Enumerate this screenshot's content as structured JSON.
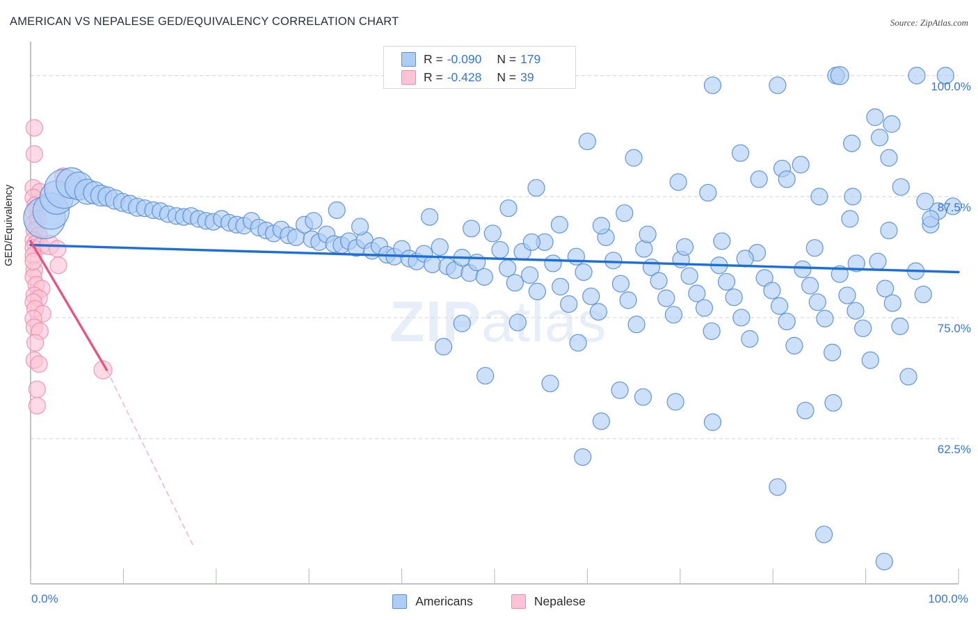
{
  "header": {
    "title": "AMERICAN VS NEPALESE GED/EQUIVALENCY CORRELATION CHART",
    "source": "Source: ZipAtlas.com"
  },
  "watermark": {
    "bold": "ZIP",
    "rest": "atlas"
  },
  "legend": {
    "rows": [
      {
        "series": "Americans",
        "color": "#aecdf5",
        "r_label": "R = ",
        "r_value": "-0.090",
        "n_label": "N = ",
        "n_value": "179"
      },
      {
        "series": "Nepalese",
        "color": "#fbc3d5",
        "r_label": "R = ",
        "r_value": "-0.428",
        "n_label": "N = ",
        "n_value": "39"
      }
    ]
  },
  "bottom_legend": [
    {
      "label": "Americans",
      "color": "#aecdf5"
    },
    {
      "label": "Nepalese",
      "color": "#fbc3d5"
    }
  ],
  "axes": {
    "y_title": "GED/Equivalency",
    "y_ticks": [
      "100.0%",
      "87.5%",
      "75.0%",
      "62.5%"
    ],
    "x_left": "0.0%",
    "x_right": "100.0%"
  },
  "chart_data": {
    "type": "scatter",
    "title": "AMERICAN VS NEPALESE GED/EQUIVALENCY CORRELATION CHART",
    "subtitle": "",
    "xlabel": "",
    "ylabel": "GED/Equivalency",
    "xlim": [
      0,
      100
    ],
    "ylim": [
      47.5,
      103.5
    ],
    "x_tick_values": [
      0,
      10,
      20,
      30,
      40,
      50,
      60,
      70,
      80,
      90,
      100
    ],
    "y_tick_values": [
      100.0,
      87.5,
      75.0,
      62.5
    ],
    "grid": "horizontal-dashed",
    "legend_position": "top-center",
    "series": [
      {
        "name": "Americans",
        "color": "#aecdf5",
        "edge": "#5b8fd6",
        "R": -0.09,
        "N": 179,
        "trend": {
          "x0": 0,
          "y0": 82.5,
          "x1": 100,
          "y1": 79.7,
          "color": "#1c6fd8",
          "style": "solid"
        },
        "points": [
          [
            1.5,
            85.3,
            30
          ],
          [
            2.2,
            86.0,
            26
          ],
          [
            2.8,
            87.4,
            24
          ],
          [
            3.6,
            88.3,
            28
          ],
          [
            4.4,
            88.9,
            22
          ],
          [
            5.2,
            88.6,
            20
          ],
          [
            6.1,
            88.0,
            18
          ],
          [
            6.9,
            87.9,
            16
          ],
          [
            7.6,
            87.6,
            15
          ],
          [
            8.3,
            87.5,
            14
          ],
          [
            9.1,
            87.2,
            14
          ],
          [
            9.9,
            86.9,
            13
          ],
          [
            10.7,
            86.7,
            13
          ],
          [
            11.5,
            86.4,
            13
          ],
          [
            12.3,
            86.3,
            12
          ],
          [
            13.2,
            86.1,
            12
          ],
          [
            14.0,
            86.0,
            12
          ],
          [
            14.8,
            85.7,
            12
          ],
          [
            15.7,
            85.5,
            12
          ],
          [
            16.5,
            85.4,
            12
          ],
          [
            17.3,
            85.5,
            12
          ],
          [
            18.1,
            85.2,
            12
          ],
          [
            18.9,
            85.0,
            12
          ],
          [
            19.7,
            84.9,
            12
          ],
          [
            20.6,
            85.2,
            12
          ],
          [
            21.4,
            84.8,
            12
          ],
          [
            22.2,
            84.6,
            12
          ],
          [
            23.0,
            84.5,
            12
          ],
          [
            23.8,
            85.0,
            12
          ],
          [
            24.6,
            84.3,
            12
          ],
          [
            25.4,
            84.0,
            12
          ],
          [
            26.2,
            83.7,
            12
          ],
          [
            27.0,
            84.1,
            12
          ],
          [
            27.8,
            83.5,
            12
          ],
          [
            28.6,
            83.3,
            12
          ],
          [
            29.5,
            84.6,
            12
          ],
          [
            30.3,
            83.1,
            12
          ],
          [
            31.1,
            82.8,
            12
          ],
          [
            31.9,
            83.6,
            12
          ],
          [
            32.7,
            82.6,
            12
          ],
          [
            33.5,
            82.5,
            12
          ],
          [
            34.3,
            82.9,
            12
          ],
          [
            35.1,
            82.2,
            12
          ],
          [
            36.0,
            83.0,
            12
          ],
          [
            36.8,
            81.9,
            12
          ],
          [
            37.6,
            82.4,
            12
          ],
          [
            38.4,
            81.5,
            12
          ],
          [
            39.2,
            81.3,
            12
          ],
          [
            40.0,
            82.1,
            12
          ],
          [
            40.8,
            81.1,
            12
          ],
          [
            41.6,
            80.8,
            12
          ],
          [
            42.4,
            81.6,
            12
          ],
          [
            43.3,
            80.5,
            12
          ],
          [
            44.1,
            82.3,
            12
          ],
          [
            44.9,
            80.3,
            12
          ],
          [
            45.7,
            79.9,
            12
          ],
          [
            46.5,
            81.2,
            12
          ],
          [
            47.3,
            79.6,
            12
          ],
          [
            48.1,
            80.7,
            12
          ],
          [
            48.9,
            79.2,
            12
          ],
          [
            49.8,
            83.7,
            12
          ],
          [
            50.6,
            82.0,
            12
          ],
          [
            51.4,
            80.1,
            12
          ],
          [
            52.2,
            78.6,
            12
          ],
          [
            53.0,
            81.8,
            12
          ],
          [
            53.8,
            79.4,
            12
          ],
          [
            54.6,
            77.7,
            12
          ],
          [
            55.4,
            82.8,
            12
          ],
          [
            56.3,
            80.6,
            12
          ],
          [
            57.1,
            78.2,
            12
          ],
          [
            58.0,
            76.4,
            12
          ],
          [
            58.8,
            81.3,
            12
          ],
          [
            59.6,
            79.7,
            12
          ],
          [
            60.4,
            77.2,
            12
          ],
          [
            61.2,
            75.6,
            12
          ],
          [
            62.0,
            83.3,
            12
          ],
          [
            62.8,
            80.9,
            12
          ],
          [
            63.6,
            78.5,
            12
          ],
          [
            64.4,
            76.8,
            12
          ],
          [
            65.3,
            74.3,
            12
          ],
          [
            66.1,
            82.1,
            12
          ],
          [
            66.9,
            80.2,
            12
          ],
          [
            67.7,
            78.8,
            12
          ],
          [
            68.5,
            77.0,
            12
          ],
          [
            69.3,
            75.3,
            12
          ],
          [
            70.1,
            81.0,
            12
          ],
          [
            71.0,
            79.3,
            12
          ],
          [
            71.8,
            77.5,
            12
          ],
          [
            72.6,
            76.0,
            12
          ],
          [
            73.4,
            73.6,
            12
          ],
          [
            74.2,
            80.4,
            12
          ],
          [
            75.0,
            78.7,
            12
          ],
          [
            75.8,
            77.1,
            12
          ],
          [
            76.6,
            75.0,
            12
          ],
          [
            77.5,
            72.8,
            12
          ],
          [
            78.3,
            81.7,
            12
          ],
          [
            79.1,
            79.1,
            12
          ],
          [
            79.9,
            77.8,
            12
          ],
          [
            80.7,
            76.2,
            12
          ],
          [
            81.5,
            74.6,
            12
          ],
          [
            82.3,
            72.1,
            12
          ],
          [
            83.2,
            80.0,
            12
          ],
          [
            84.0,
            78.3,
            12
          ],
          [
            84.8,
            76.6,
            12
          ],
          [
            85.6,
            74.9,
            12
          ],
          [
            86.4,
            71.4,
            12
          ],
          [
            87.2,
            79.5,
            12
          ],
          [
            88.0,
            77.3,
            12
          ],
          [
            88.9,
            75.7,
            12
          ],
          [
            89.7,
            73.9,
            12
          ],
          [
            90.5,
            70.6,
            12
          ],
          [
            91.3,
            80.8,
            12
          ],
          [
            92.1,
            78.0,
            12
          ],
          [
            92.9,
            76.5,
            12
          ],
          [
            93.7,
            74.1,
            12
          ],
          [
            94.6,
            68.9,
            12
          ],
          [
            95.4,
            79.8,
            12
          ],
          [
            96.2,
            77.4,
            12
          ],
          [
            97.0,
            84.6,
            12
          ],
          [
            97.8,
            86.0,
            12
          ],
          [
            98.6,
            100.0,
            12
          ],
          [
            86.8,
            100.0,
            12
          ],
          [
            87.2,
            100.0,
            13
          ],
          [
            95.5,
            100.0,
            12
          ],
          [
            73.5,
            99.0,
            12
          ],
          [
            80.5,
            99.0,
            12
          ],
          [
            91.0,
            95.7,
            12
          ],
          [
            88.5,
            93.0,
            12
          ],
          [
            91.5,
            93.6,
            12
          ],
          [
            92.5,
            91.5,
            12
          ],
          [
            83.0,
            90.8,
            12
          ],
          [
            60.0,
            93.2,
            12
          ],
          [
            65.0,
            91.5,
            12
          ],
          [
            76.5,
            92.0,
            12
          ],
          [
            81.0,
            90.4,
            12
          ],
          [
            92.8,
            95.0,
            12
          ],
          [
            78.5,
            89.3,
            12
          ],
          [
            73.0,
            87.9,
            12
          ],
          [
            54.5,
            88.4,
            12
          ],
          [
            69.8,
            89.0,
            12
          ],
          [
            81.5,
            89.3,
            12
          ],
          [
            85.0,
            87.5,
            12
          ],
          [
            88.6,
            87.5,
            12
          ],
          [
            93.8,
            88.5,
            12
          ],
          [
            96.4,
            87.0,
            12
          ],
          [
            99.4,
            86.5,
            12
          ],
          [
            51.5,
            86.3,
            12
          ],
          [
            33.0,
            86.1,
            12
          ],
          [
            64.0,
            85.8,
            12
          ],
          [
            61.5,
            84.5,
            12
          ],
          [
            43.0,
            85.4,
            12
          ],
          [
            35.5,
            84.4,
            12
          ],
          [
            88.3,
            85.2,
            12
          ],
          [
            92.5,
            84.0,
            12
          ],
          [
            97.0,
            85.2,
            12
          ],
          [
            47.5,
            84.2,
            12
          ],
          [
            30.5,
            85.0,
            12
          ],
          [
            57.0,
            84.6,
            12
          ],
          [
            54.0,
            82.8,
            12
          ],
          [
            66.5,
            83.6,
            12
          ],
          [
            70.5,
            82.3,
            12
          ],
          [
            74.5,
            82.9,
            12
          ],
          [
            77.0,
            81.1,
            12
          ],
          [
            84.5,
            82.2,
            12
          ],
          [
            89.0,
            80.6,
            12
          ],
          [
            59.0,
            72.4,
            12
          ],
          [
            52.5,
            74.5,
            12
          ],
          [
            46.5,
            74.4,
            12
          ],
          [
            44.5,
            72.0,
            12
          ],
          [
            49.0,
            69.0,
            12
          ],
          [
            56.0,
            68.2,
            12
          ],
          [
            63.5,
            67.5,
            12
          ],
          [
            66.0,
            66.8,
            12
          ],
          [
            69.5,
            66.3,
            12
          ],
          [
            61.5,
            64.3,
            12
          ],
          [
            73.5,
            64.2,
            12
          ],
          [
            83.5,
            65.4,
            12
          ],
          [
            86.5,
            66.2,
            12
          ],
          [
            59.5,
            60.6,
            12
          ],
          [
            80.5,
            57.5,
            12
          ],
          [
            85.5,
            52.6,
            12
          ],
          [
            92.0,
            49.8,
            12
          ]
        ]
      },
      {
        "name": "Nepalese",
        "color": "#fbc3d5",
        "edge": "#f090ae",
        "R": -0.428,
        "N": 39,
        "trend": {
          "x0": 0.0,
          "y0": 82.9,
          "x1": 8.2,
          "y1": 69.6,
          "color": "#e8537f",
          "style": "solid"
        },
        "trend_extension": {
          "x0": 8.2,
          "y0": 69.6,
          "x1": 17.6,
          "y1": 51.3,
          "color": "#f4aec2",
          "style": "dashed"
        },
        "points": [
          [
            0.4,
            94.6,
            12
          ],
          [
            0.4,
            91.9,
            12
          ],
          [
            3.5,
            89.6,
            12
          ],
          [
            0.3,
            88.4,
            12
          ],
          [
            1.0,
            88.0,
            12
          ],
          [
            0.3,
            87.4,
            12
          ],
          [
            0.5,
            86.6,
            12
          ],
          [
            0.3,
            85.9,
            12
          ],
          [
            0.8,
            85.2,
            12
          ],
          [
            0.3,
            84.7,
            12
          ],
          [
            0.4,
            84.0,
            12
          ],
          [
            0.9,
            83.5,
            12
          ],
          [
            0.3,
            83.0,
            12
          ],
          [
            0.5,
            82.6,
            12
          ],
          [
            0.3,
            82.2,
            12
          ],
          [
            1.1,
            82.4,
            12
          ],
          [
            2.0,
            82.5,
            14
          ],
          [
            2.9,
            82.1,
            12
          ],
          [
            0.3,
            81.4,
            12
          ],
          [
            3.0,
            80.4,
            12
          ],
          [
            0.4,
            79.9,
            12
          ],
          [
            0.3,
            79.2,
            12
          ],
          [
            0.6,
            78.4,
            12
          ],
          [
            1.2,
            78.0,
            12
          ],
          [
            0.4,
            77.3,
            12
          ],
          [
            0.9,
            77.0,
            12
          ],
          [
            0.3,
            76.6,
            12
          ],
          [
            0.5,
            75.9,
            12
          ],
          [
            1.3,
            75.4,
            12
          ],
          [
            0.3,
            74.9,
            12
          ],
          [
            0.4,
            74.0,
            12
          ],
          [
            1.0,
            73.6,
            12
          ],
          [
            0.5,
            72.4,
            12
          ],
          [
            0.4,
            70.6,
            12
          ],
          [
            0.9,
            70.2,
            12
          ],
          [
            7.8,
            69.6,
            13
          ],
          [
            0.7,
            67.6,
            12
          ],
          [
            0.7,
            65.9,
            12
          ],
          [
            0.3,
            80.8,
            12
          ]
        ]
      }
    ]
  }
}
